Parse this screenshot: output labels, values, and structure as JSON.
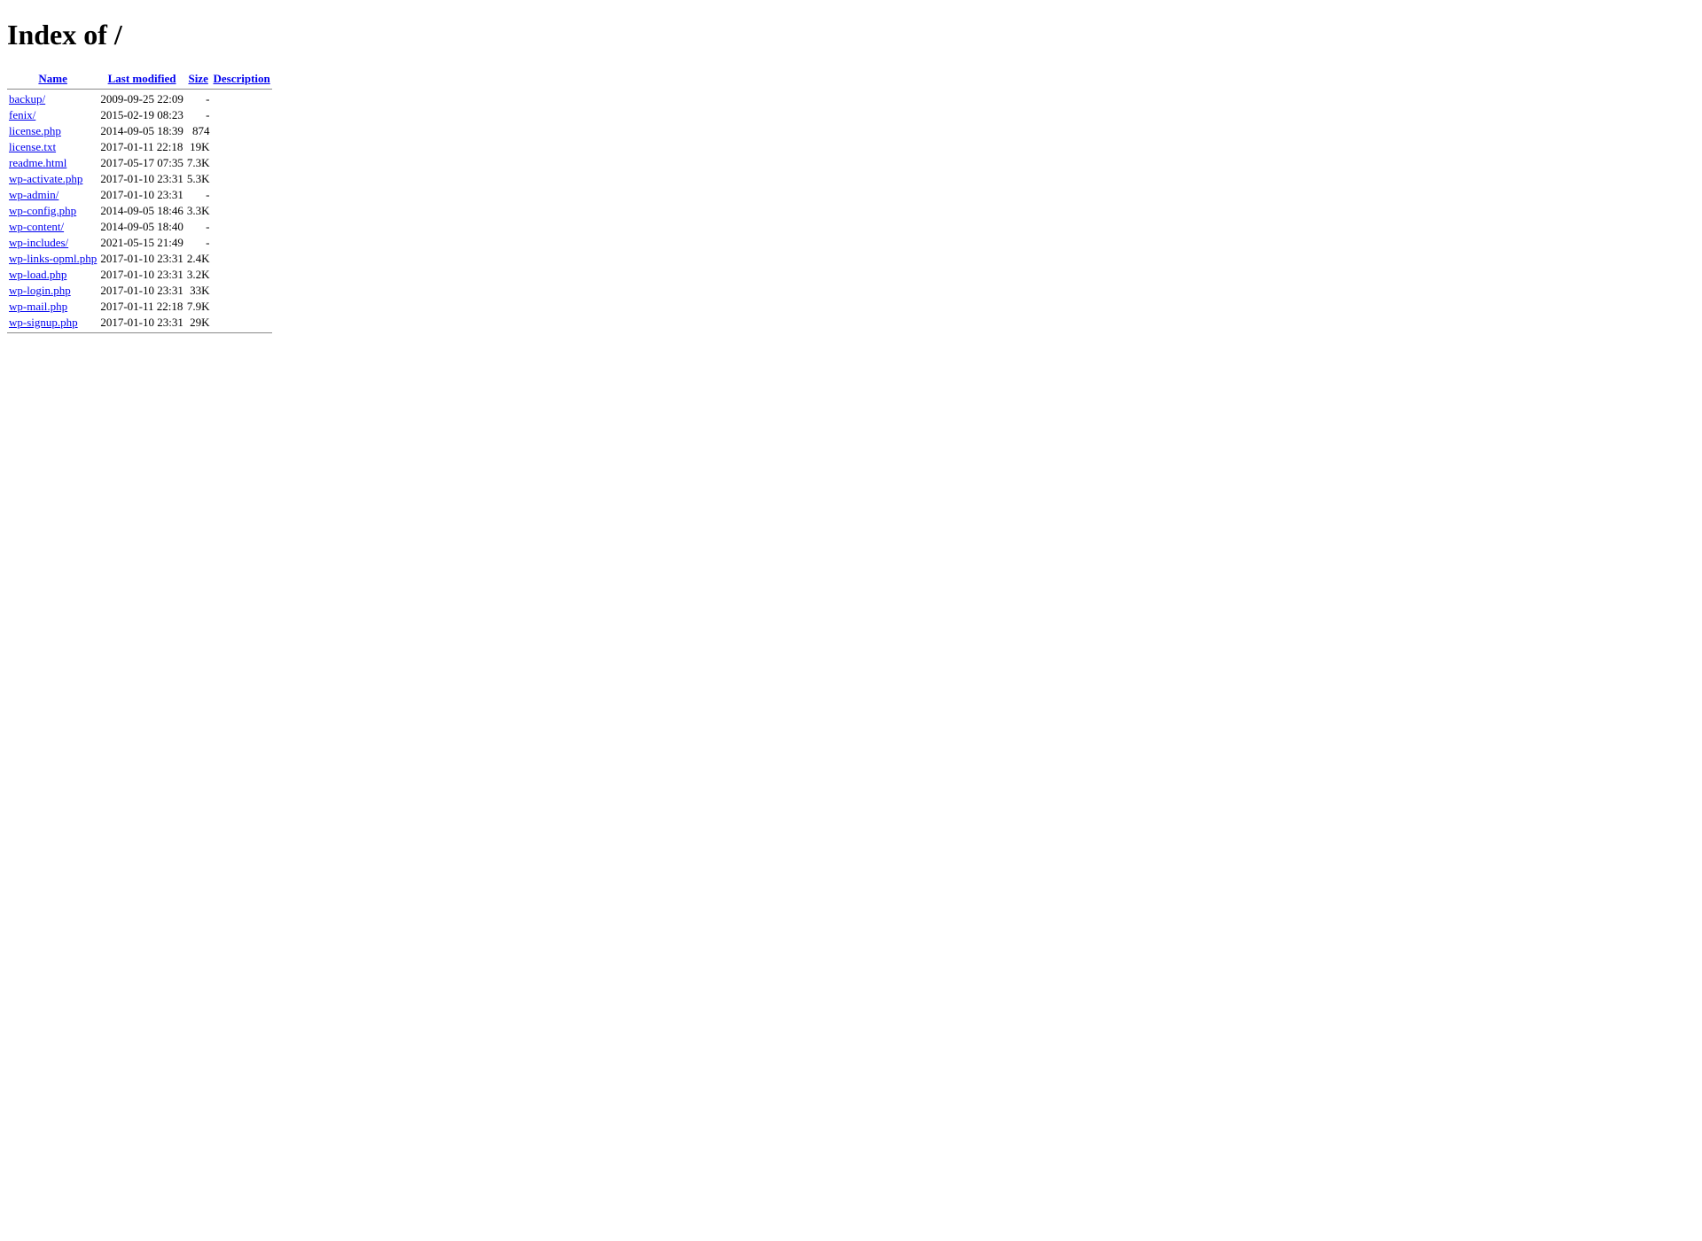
{
  "title": "Index of /",
  "columns": {
    "name": "Name",
    "last_modified": "Last modified",
    "size": "Size",
    "description": "Description"
  },
  "entries": [
    {
      "name": "backup/",
      "modified": "2009-09-25 22:09",
      "size": "-",
      "desc": ""
    },
    {
      "name": "fenix/",
      "modified": "2015-02-19 08:23",
      "size": "-",
      "desc": ""
    },
    {
      "name": "license.php",
      "modified": "2014-09-05 18:39",
      "size": "874",
      "desc": ""
    },
    {
      "name": "license.txt",
      "modified": "2017-01-11 22:18",
      "size": "19K",
      "desc": ""
    },
    {
      "name": "readme.html",
      "modified": "2017-05-17 07:35",
      "size": "7.3K",
      "desc": ""
    },
    {
      "name": "wp-activate.php",
      "modified": "2017-01-10 23:31",
      "size": "5.3K",
      "desc": ""
    },
    {
      "name": "wp-admin/",
      "modified": "2017-01-10 23:31",
      "size": "-",
      "desc": ""
    },
    {
      "name": "wp-config.php",
      "modified": "2014-09-05 18:46",
      "size": "3.3K",
      "desc": ""
    },
    {
      "name": "wp-content/",
      "modified": "2014-09-05 18:40",
      "size": "-",
      "desc": ""
    },
    {
      "name": "wp-includes/",
      "modified": "2021-05-15 21:49",
      "size": "-",
      "desc": ""
    },
    {
      "name": "wp-links-opml.php",
      "modified": "2017-01-10 23:31",
      "size": "2.4K",
      "desc": ""
    },
    {
      "name": "wp-load.php",
      "modified": "2017-01-10 23:31",
      "size": "3.2K",
      "desc": ""
    },
    {
      "name": "wp-login.php",
      "modified": "2017-01-10 23:31",
      "size": "33K",
      "desc": ""
    },
    {
      "name": "wp-mail.php",
      "modified": "2017-01-11 22:18",
      "size": "7.9K",
      "desc": ""
    },
    {
      "name": "wp-signup.php",
      "modified": "2017-01-10 23:31",
      "size": "29K",
      "desc": ""
    }
  ]
}
